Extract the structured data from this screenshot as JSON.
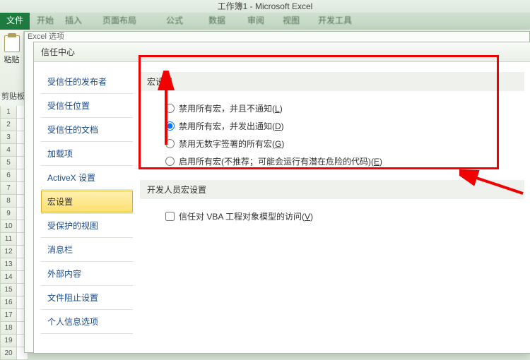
{
  "app": {
    "title": "工作簿1 - Microsoft Excel"
  },
  "ribbon": {
    "file": "文件",
    "tabs": [
      "开始",
      "插入",
      "页面布局",
      "公式",
      "数据",
      "审阅",
      "视图",
      "开发工具"
    ],
    "paste": "粘贴",
    "clipboard": "剪贴板"
  },
  "outer_dialog_title": "Excel 选项",
  "dialog": {
    "title": "信任中心"
  },
  "nav": {
    "items": [
      "受信任的发布者",
      "受信任位置",
      "受信任的文档",
      "加载项",
      "ActiveX 设置",
      "宏设置",
      "受保护的视图",
      "消息栏",
      "外部内容",
      "文件阻止设置",
      "个人信息选项"
    ],
    "selected_index": 5
  },
  "macro": {
    "header": "宏设置",
    "options": [
      {
        "label_pre": "禁用所有宏，并且不通知(",
        "hotkey": "L",
        "label_post": ")"
      },
      {
        "label_pre": "禁用所有宏，并发出通知(",
        "hotkey": "D",
        "label_post": ")"
      },
      {
        "label_pre": "禁用无数字签署的所有宏(",
        "hotkey": "G",
        "label_post": ")"
      },
      {
        "label_pre": "启用所有宏(不推荐；可能会运行有潜在危险的代码)(",
        "hotkey": "E",
        "label_post": ")"
      }
    ],
    "selected_index": 1
  },
  "dev": {
    "header": "开发人员宏设置",
    "trust_vba_pre": "信任对 VBA 工程对象模型的访问(",
    "trust_vba_hotkey": "V",
    "trust_vba_post": ")",
    "trust_vba_checked": false
  },
  "annotation": {
    "color": "#f00000"
  }
}
